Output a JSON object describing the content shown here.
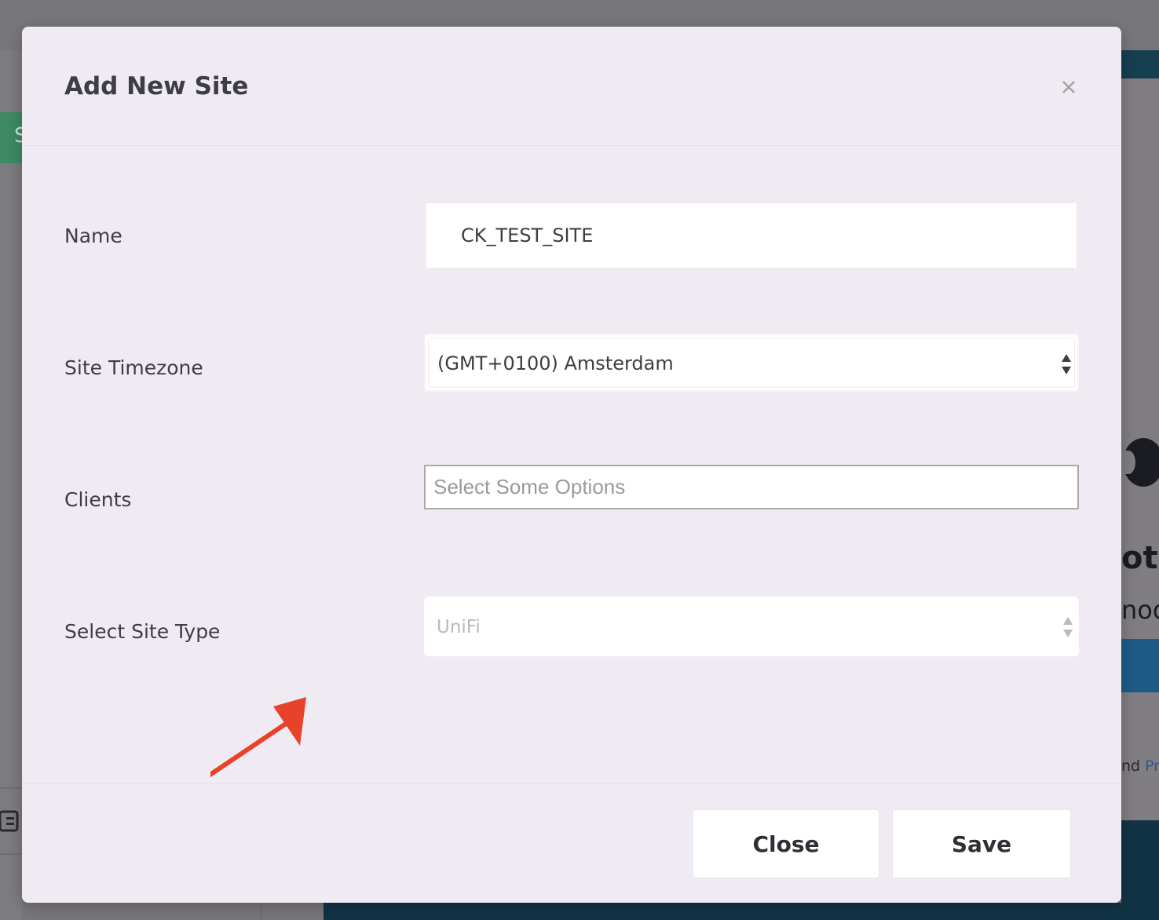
{
  "background": {
    "partial_tab_letter": "S",
    "partial_heading": "ots",
    "partial_subtext": "nod",
    "partial_footer_text": "nd",
    "partial_footer_link": "Pr"
  },
  "modal": {
    "title": "Add New Site",
    "close_icon": "close-icon",
    "fields": {
      "name": {
        "label": "Name",
        "value": "CK_TEST_SITE"
      },
      "timezone": {
        "label": "Site Timezone",
        "selected": "(GMT+0100) Amsterdam"
      },
      "clients": {
        "label": "Clients",
        "placeholder": "Select Some Options"
      },
      "site_type": {
        "label": "Select Site Type",
        "selected": "UniFi"
      }
    },
    "footer": {
      "close_label": "Close",
      "save_label": "Save"
    }
  },
  "annotation": {
    "arrow_color": "#e8432a"
  }
}
